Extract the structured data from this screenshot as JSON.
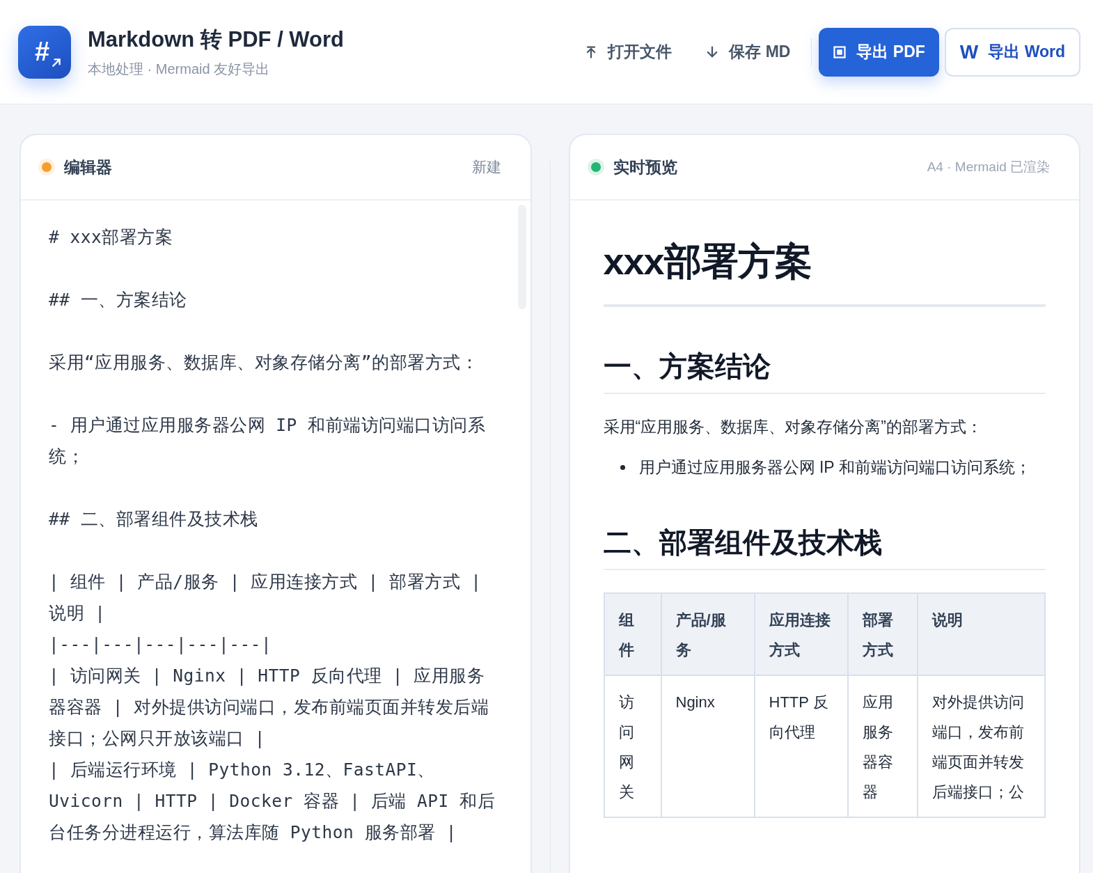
{
  "app": {
    "logo_text": "#",
    "title": "Markdown 转 PDF / Word",
    "subtitle": "本地处理 · Mermaid 友好导出"
  },
  "toolbar": [
    {
      "kind": "upload",
      "label": "打开文件"
    },
    {
      "kind": "download",
      "label": "保存 MD"
    },
    {
      "kind": "primary",
      "label": "导出 PDF"
    },
    {
      "kind": "word",
      "icon_text": "W",
      "label": "导出 Word"
    }
  ],
  "editor": {
    "title": "编辑器",
    "color": "#f59e2e",
    "action": "新建",
    "blocks": [
      [
        "# xxx部署方案"
      ],
      [
        "## 一、方案结论"
      ],
      [
        "采用“应用服务、数据库、对象存储分离”的部署方式："
      ],
      [
        "- 用户通过应用服务器公网 IP 和前端访问端口访问系统；"
      ],
      [
        "## 二、部署组件及技术栈"
      ],
      [
        "| 组件 | 产品/服务 | 应用连接方式 | 部署方式 | 说明 |",
        "|---|---|---|---|---|",
        "| 访问网关 | Nginx | HTTP 反向代理 | 应用服务器容器 | 对外提供访问端口，发布前端页面并转发后端接口；公网只开放该端口 |",
        "| 后端运行环境 | Python 3.12、FastAPI、Uvicorn | HTTP | Docker 容器 | 后端 API 和后台任务分进程运行，算法库随 Python 服务部署 |"
      ]
    ]
  },
  "preview": {
    "title": "实时预览",
    "color": "#22b573",
    "status": "A4 · Mermaid 已渲染",
    "blocks": [
      {
        "kind": "h1",
        "text": "xxx部署方案"
      },
      {
        "kind": "h2",
        "text": "一、方案结论"
      },
      {
        "kind": "p",
        "text": "采用“应用服务、数据库、对象存储分离”的部署方式："
      },
      {
        "kind": "ul",
        "items": [
          "用户通过应用服务器公网 IP 和前端访问端口访问系统；"
        ]
      },
      {
        "kind": "h2",
        "text": "二、部署组件及技术栈"
      },
      {
        "kind": "table",
        "columns": [
          "组件",
          "产品/服务",
          "应用连接方式",
          "部署方式",
          "说明"
        ],
        "rows": [
          [
            "访问网关",
            "Nginx",
            "HTTP 反向代理",
            "应用服务器容器",
            "对外提供访问端口，发布前端页面并转发后端接口；公"
          ]
        ]
      }
    ]
  }
}
